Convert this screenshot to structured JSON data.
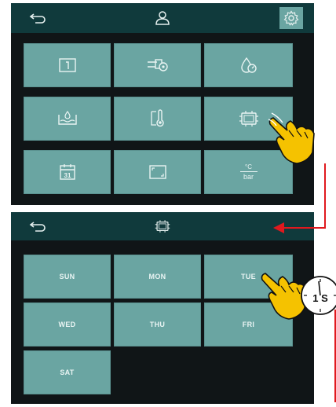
{
  "screen1": {
    "tiles": [
      {
        "icon": "date-window-icon"
      },
      {
        "icon": "valve-settings-icon"
      },
      {
        "icon": "water-pressure-gauge-icon"
      },
      {
        "icon": "water-level-icon"
      },
      {
        "icon": "thermometer-icon"
      },
      {
        "icon": "weekly-timer-icon"
      },
      {
        "icon": "calendar-31-icon"
      },
      {
        "icon": "screen-frame-icon"
      },
      {
        "icon": "units-icon",
        "text_top": "°C",
        "text_bottom": "bar"
      }
    ]
  },
  "screen2": {
    "days": [
      "SUN",
      "MON",
      "TUE",
      "WED",
      "THU",
      "FRI",
      "SAT"
    ]
  },
  "timer_badge": "1 S",
  "colors": {
    "panel_bg": "#101517",
    "header_bg": "#103a3c",
    "tile": "#6aa5a2",
    "arrow": "#e0191e",
    "hand": "#f5c200"
  }
}
